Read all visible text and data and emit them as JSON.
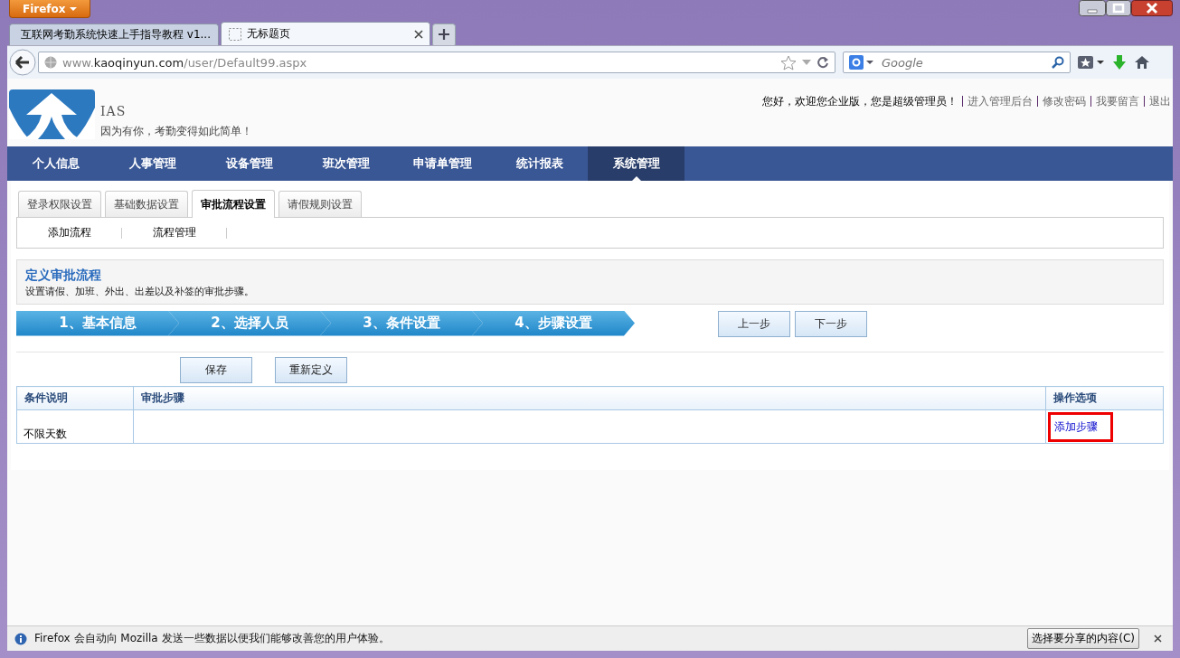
{
  "browser": {
    "app_button": "Firefox",
    "tabs": [
      {
        "title": "互联网考勤系统快速上手指导教程 v1...",
        "selected": false
      },
      {
        "title": "无标题页",
        "selected": true
      }
    ],
    "url": "www.**kaoqinyun.com**/user/Default99.aspx",
    "search_placeholder": "Google"
  },
  "header": {
    "logo_text": "IAS",
    "slogan": "因为有你，考勤变得如此简单！",
    "greeting": "您好，欢迎您企业版，您是超级管理员！",
    "links": [
      "进入管理后台",
      "修改密码",
      "我要留言",
      "退出"
    ]
  },
  "main_nav": [
    {
      "label": "个人信息",
      "selected": false
    },
    {
      "label": "人事管理",
      "selected": false
    },
    {
      "label": "设备管理",
      "selected": false
    },
    {
      "label": "班次管理",
      "selected": false
    },
    {
      "label": "申请单管理",
      "selected": false
    },
    {
      "label": "统计报表",
      "selected": false
    },
    {
      "label": "系统管理",
      "selected": true
    }
  ],
  "sub_tabs": [
    {
      "label": "登录权限设置",
      "selected": false
    },
    {
      "label": "基础数据设置",
      "selected": false
    },
    {
      "label": "审批流程设置",
      "selected": true
    },
    {
      "label": "请假规则设置",
      "selected": false
    }
  ],
  "sub_menu": [
    "添加流程",
    "流程管理"
  ],
  "section": {
    "title": "定义审批流程",
    "description": "设置请假、加班、外出、出差以及补签的审批步骤。"
  },
  "steps": [
    "1、基本信息",
    "2、选择人员",
    "3、条件设置",
    "4、步骤设置"
  ],
  "step_buttons": [
    "上一步",
    "下一步"
  ],
  "actions": [
    "保存",
    "重新定义"
  ],
  "table": {
    "columns": [
      "条件说明",
      "审批步骤",
      "操作选项"
    ],
    "rows": [
      {
        "condition": "不限天数",
        "action": "添加步骤",
        "highlighted": true
      }
    ]
  },
  "notification": {
    "message": "Firefox 会自动向 Mozilla 发送一些数据以便我们能够改善您的用户体验。",
    "button": "选择要分享的内容(C)"
  }
}
